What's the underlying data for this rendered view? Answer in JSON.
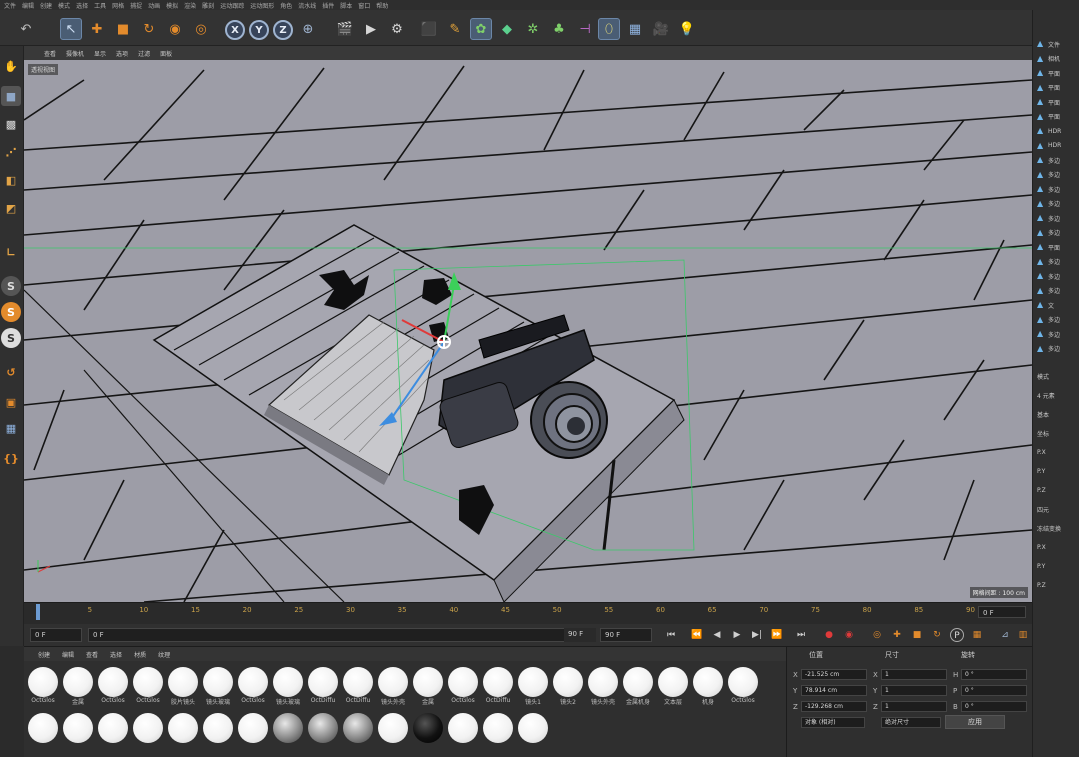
{
  "menubar": {
    "items": [
      "文件",
      "编辑",
      "创建",
      "模式",
      "选择",
      "工具",
      "网格",
      "捕捉",
      "动画",
      "模拟",
      "渲染",
      "雕刻",
      "运动跟踪",
      "运动图形",
      "角色",
      "流水线",
      "插件",
      "脚本",
      "窗口",
      "帮助"
    ]
  },
  "toolbar": {
    "undo_icon": "undo-icon",
    "axis_labels": [
      "X",
      "Y",
      "Z"
    ]
  },
  "viewport": {
    "menu": [
      "查看",
      "摄像机",
      "显示",
      "选项",
      "过滤",
      "面板"
    ],
    "label": "透视视图",
    "grid_info": "网格间距 : 100 cm",
    "colors": {
      "sky": "#8f8f98",
      "plank": "#9c9ca6",
      "line": "#111111",
      "accent": "#3cc86a"
    }
  },
  "timeline": {
    "ticks": [
      "0",
      "5",
      "10",
      "15",
      "20",
      "25",
      "30",
      "35",
      "40",
      "45",
      "50",
      "55",
      "60",
      "65",
      "70",
      "75",
      "80",
      "85",
      "90"
    ],
    "end_field": "0 F"
  },
  "transport": {
    "start_frame": "0 F",
    "current_frame": "0 F",
    "end_frame": "90 F",
    "max_frame": "90 F"
  },
  "material_panel": {
    "menu": [
      "创建",
      "编辑",
      "查看",
      "选择",
      "材质",
      "纹理"
    ],
    "row1": [
      "OctGlos",
      "金属",
      "OctGlos",
      "OctGlos",
      "胶片镜头",
      "镜头玻璃",
      "OctGlos",
      "镜头玻璃",
      "OctDiffu",
      "OctDiffu",
      "镜头外壳",
      "金属",
      "OctGlos",
      "OctDiffu",
      "镜头1",
      "镜头2",
      "镜头外壳",
      "金属机身",
      "文本层",
      "机身",
      "OctGlos"
    ],
    "row2": [
      "",
      "",
      "",
      "",
      "",
      "",
      "",
      "",
      "",
      "",
      "",
      "",
      "",
      "",
      ""
    ]
  },
  "coordinates": {
    "headers": [
      "位置",
      "尺寸",
      "旋转"
    ],
    "rows": [
      {
        "axis": "X",
        "pos": "-21.525 cm",
        "size_axis": "X",
        "size": "1",
        "rot_axis": "H",
        "rot": "0 °"
      },
      {
        "axis": "Y",
        "pos": "78.914 cm",
        "size_axis": "Y",
        "size": "1",
        "rot_axis": "P",
        "rot": "0 °"
      },
      {
        "axis": "Z",
        "pos": "-129.268 cm",
        "size_axis": "Z",
        "size": "1",
        "rot_axis": "B",
        "rot": "0 °"
      }
    ],
    "mode": "对象 (相对)",
    "size_mode": "绝对尺寸",
    "apply": "应用"
  },
  "right_panel": {
    "items": [
      "文件",
      "相机",
      "平面",
      "平面",
      "平面",
      "平面",
      "HDR",
      "HDR",
      "多边",
      "多边",
      "多边",
      "多边",
      "多边",
      "多边",
      "平面",
      "多边",
      "多边",
      "多边",
      "文",
      "多边",
      "多边",
      "多边"
    ],
    "attr_labels": [
      "模式",
      "4 元素",
      "基本",
      "坐标",
      "P.X",
      "P.Y",
      "P.Z",
      "四元",
      "冻结变换",
      "P.X",
      "P.Y",
      "P.Z"
    ]
  }
}
